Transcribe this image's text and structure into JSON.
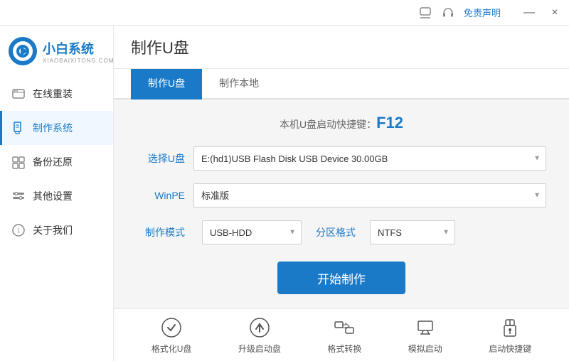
{
  "titlebar": {
    "free_label": "免责声明",
    "minimize_label": "—",
    "close_label": "×"
  },
  "logo": {
    "main": "小白系统",
    "sub": "XIAOBAIXITONG.COM"
  },
  "sidebar": {
    "items": [
      {
        "id": "online-reinstall",
        "label": "在线重装",
        "active": false
      },
      {
        "id": "make-system",
        "label": "制作系统",
        "active": true
      },
      {
        "id": "backup-restore",
        "label": "备份还原",
        "active": false
      },
      {
        "id": "other-settings",
        "label": "其他设置",
        "active": false
      },
      {
        "id": "about-us",
        "label": "关于我们",
        "active": false
      }
    ]
  },
  "page": {
    "title": "制作U盘"
  },
  "tabs": [
    {
      "id": "make-usb",
      "label": "制作U盘",
      "active": true
    },
    {
      "id": "make-local",
      "label": "制作本地",
      "active": false
    }
  ],
  "form": {
    "hotkey_prefix": "本机U盘启动快捷键：",
    "hotkey_key": "F12",
    "select_usb_label": "选择U盘",
    "select_usb_value": "E:(hd1)USB Flash Disk USB Device 30.00GB",
    "winpe_label": "WinPE",
    "winpe_value": "标准版",
    "make_mode_label": "制作模式",
    "make_mode_value": "USB-HDD",
    "partition_label": "分区格式",
    "partition_value": "NTFS",
    "start_btn_label": "开始制作"
  },
  "bottom_tools": [
    {
      "id": "format-usb",
      "label": "格式化U盘",
      "icon": "check-circle"
    },
    {
      "id": "upgrade-boot",
      "label": "升级启动盘",
      "icon": "upload-circle"
    },
    {
      "id": "format-convert",
      "label": "格式转换",
      "icon": "convert"
    },
    {
      "id": "simulate-boot",
      "label": "模拟启动",
      "icon": "computer"
    },
    {
      "id": "boot-shortcut",
      "label": "启动快捷键",
      "icon": "lock"
    }
  ],
  "colors": {
    "primary": "#1a7ac8",
    "active_bg": "#f0f7ff"
  }
}
